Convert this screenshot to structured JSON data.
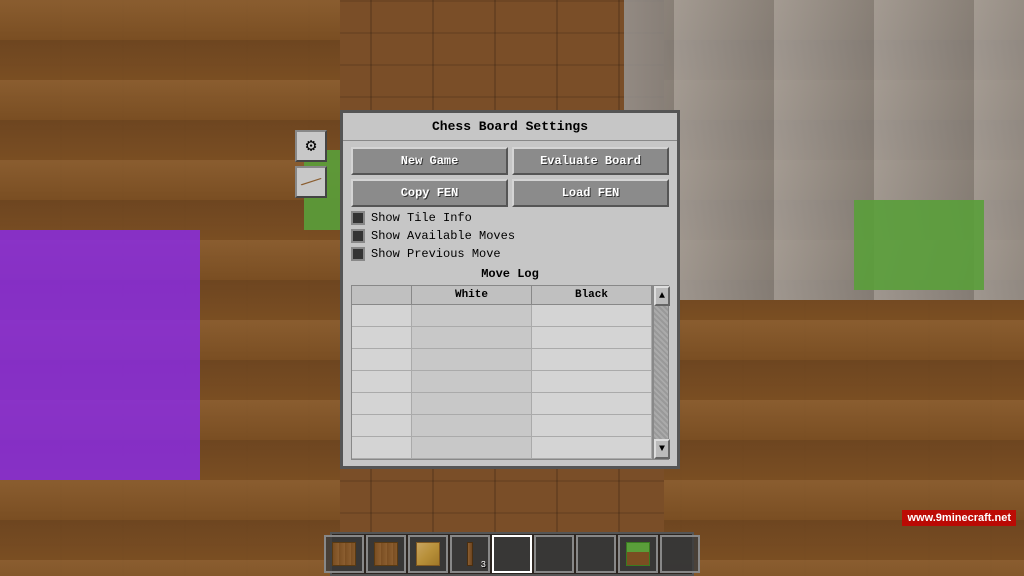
{
  "background": {
    "description": "Minecraft game background with wooden planks, stone, grass blocks, and purple bed"
  },
  "dialog": {
    "title": "Chess Board Settings",
    "buttons": {
      "new_game": "New Game",
      "evaluate_board": "Evaluate Board",
      "copy_fen": "Copy FEN",
      "load_fen": "Load FEN"
    },
    "checkboxes": [
      {
        "id": "show_tile_info",
        "label": "Show Tile Info",
        "checked": false
      },
      {
        "id": "show_available_moves",
        "label": "Show Available Moves",
        "checked": false
      },
      {
        "id": "show_previous_move",
        "label": "Show Previous Move",
        "checked": false
      }
    ],
    "move_log": {
      "title": "Move Log",
      "columns": [
        "",
        "White",
        "Black"
      ],
      "rows": [
        [
          "",
          "",
          ""
        ],
        [
          "",
          "",
          ""
        ],
        [
          "",
          "",
          ""
        ],
        [
          "",
          "",
          ""
        ],
        [
          "",
          "",
          ""
        ],
        [
          "",
          "",
          ""
        ],
        [
          "",
          "",
          ""
        ]
      ]
    }
  },
  "hotbar": {
    "slots": [
      {
        "icon": "wood",
        "count": null,
        "selected": false
      },
      {
        "icon": "wood",
        "count": null,
        "selected": false
      },
      {
        "icon": "wood2",
        "count": null,
        "selected": false
      },
      {
        "icon": "stick",
        "count": "3",
        "selected": false
      },
      {
        "icon": "empty",
        "count": null,
        "selected": true
      },
      {
        "icon": "empty",
        "count": null,
        "selected": false
      },
      {
        "icon": "empty",
        "count": null,
        "selected": false
      },
      {
        "icon": "grass",
        "count": null,
        "selected": false
      },
      {
        "icon": "empty",
        "count": null,
        "selected": false
      }
    ]
  },
  "sidebar_icons": {
    "gear_icon": "⚙",
    "stick_icon": "/"
  },
  "watermark": {
    "text": "www.9minecraft.net"
  }
}
